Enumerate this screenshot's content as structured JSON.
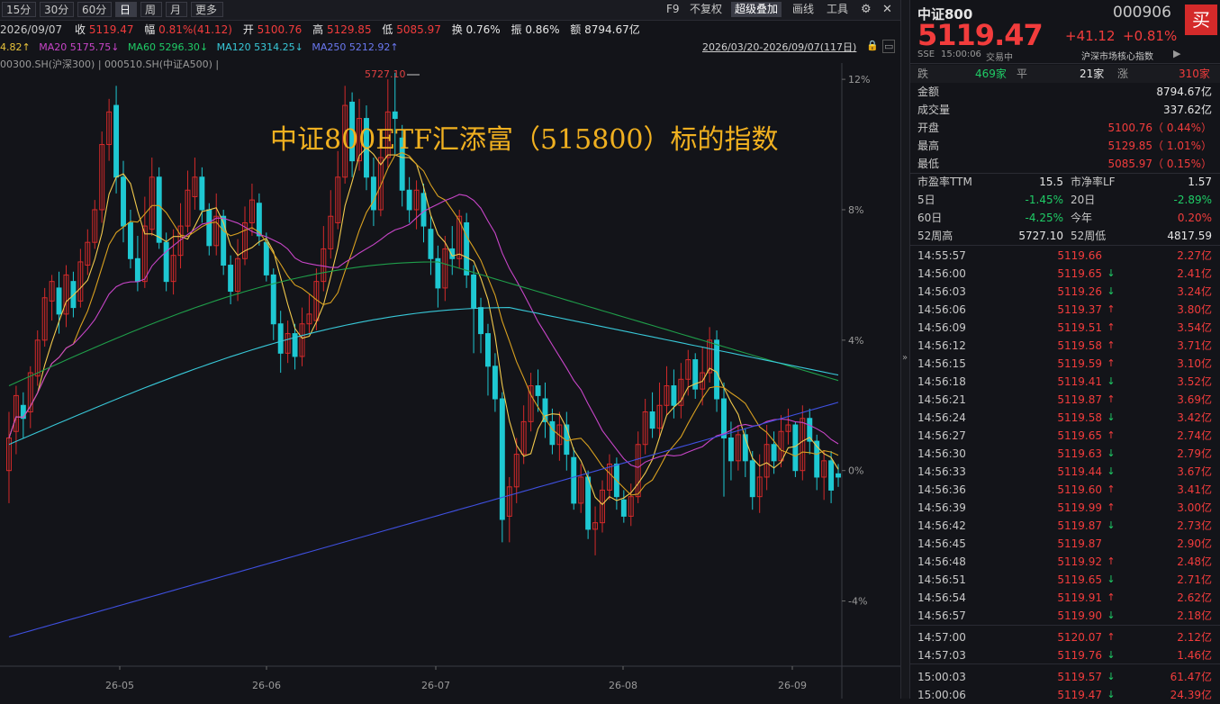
{
  "toolbar": {
    "periods": [
      "15分",
      "30分",
      "60分",
      "日",
      "周",
      "月",
      "更多"
    ],
    "active_period": "日",
    "right_items": [
      "F9",
      "不复权",
      "超级叠加",
      "画线",
      "工具"
    ],
    "active_right": "超级叠加"
  },
  "quote_line": {
    "date": "2026/09/07",
    "close_label": "收",
    "close": "5119.47",
    "change_label": "幅",
    "change": "0.81%(41.12)",
    "open_label": "开",
    "open": "5100.76",
    "high_label": "高",
    "high": "5129.85",
    "low_label": "低",
    "low": "5085.97",
    "turnover_label": "换",
    "turnover": "0.76%",
    "amplitude_label": "振",
    "amplitude": "0.86%",
    "amount_label": "额",
    "amount": "8794.67亿"
  },
  "ma_line": {
    "ma10": "4.82↑",
    "ma20": "MA20 5175.75↓",
    "ma60": "MA60 5296.30↓",
    "ma120": "MA120 5314.25↓",
    "ma250": "MA250 5212.92↑",
    "range": "2026/03/20-2026/09/07(117日)"
  },
  "overlay_line": "00300.SH(沪深300) | 000510.SH(中证A500) |",
  "annotation": "中证800ETF汇添富（515800）标的指数",
  "peak_label": "5727.10",
  "colors": {
    "up": "#d42a2a",
    "down": "#1ec8d2",
    "ma5": "#e6b422",
    "ma10": "#e6b422",
    "ma20": "#c845c8",
    "ma60": "#1f9e4a",
    "ma120": "#38c8d8",
    "ma250": "#3f50e0",
    "annotation": "#f0b020"
  },
  "chart_data": {
    "type": "candlestick",
    "x_labels": [
      "26-05",
      "26-06",
      "26-07",
      "26-08",
      "26-09"
    ],
    "y_ticks": [
      "12%",
      "8%",
      "4%",
      "0%",
      "-4%"
    ],
    "ylim_pct": [
      -6,
      12.5
    ],
    "series_pct": [
      [
        0.0,
        1.0,
        -1.0,
        1.8
      ],
      [
        1.2,
        2.3,
        0.5,
        2.6
      ],
      [
        2.0,
        1.6,
        1.0,
        2.4
      ],
      [
        1.8,
        3.0,
        1.3,
        3.2
      ],
      [
        2.9,
        4.0,
        2.6,
        4.3
      ],
      [
        4.0,
        5.3,
        3.8,
        5.6
      ],
      [
        5.2,
        5.8,
        4.6,
        6.0
      ],
      [
        5.6,
        4.8,
        4.2,
        6.1
      ],
      [
        4.8,
        6.0,
        4.4,
        6.3
      ],
      [
        5.8,
        5.0,
        4.7,
        6.1
      ],
      [
        5.2,
        6.4,
        5.0,
        6.8
      ],
      [
        6.3,
        7.0,
        6.0,
        7.4
      ],
      [
        7.0,
        8.0,
        6.8,
        8.3
      ],
      [
        8.0,
        10.0,
        7.6,
        10.4
      ],
      [
        10.0,
        11.0,
        9.5,
        11.4
      ],
      [
        11.2,
        9.0,
        8.5,
        11.8
      ],
      [
        9.0,
        7.5,
        7.0,
        9.5
      ],
      [
        7.6,
        6.5,
        6.2,
        8.0
      ],
      [
        6.5,
        5.8,
        5.5,
        7.2
      ],
      [
        5.8,
        7.5,
        5.6,
        8.4
      ],
      [
        7.4,
        9.0,
        7.2,
        9.6
      ],
      [
        9.0,
        7.0,
        6.8,
        9.3
      ],
      [
        7.0,
        5.8,
        5.5,
        7.3
      ],
      [
        5.8,
        6.6,
        5.4,
        7.4
      ],
      [
        6.6,
        7.5,
        6.2,
        8.2
      ],
      [
        7.5,
        8.6,
        7.3,
        9.2
      ],
      [
        8.4,
        9.0,
        8.0,
        9.6
      ],
      [
        9.0,
        8.0,
        7.6,
        9.3
      ],
      [
        8.0,
        6.9,
        6.6,
        8.2
      ],
      [
        6.9,
        7.8,
        6.6,
        8.5
      ],
      [
        7.8,
        6.3,
        6.0,
        8.0
      ],
      [
        6.3,
        5.5,
        5.1,
        6.6
      ],
      [
        5.5,
        6.5,
        5.2,
        7.1
      ],
      [
        6.5,
        7.6,
        6.3,
        8.1
      ],
      [
        7.6,
        8.3,
        7.2,
        8.8
      ],
      [
        8.2,
        7.2,
        6.9,
        8.5
      ],
      [
        7.0,
        6.0,
        5.8,
        7.3
      ],
      [
        6.0,
        4.5,
        4.0,
        6.2
      ],
      [
        4.5,
        3.6,
        3.0,
        4.9
      ],
      [
        3.6,
        4.2,
        3.3,
        4.6
      ],
      [
        4.2,
        3.5,
        3.1,
        4.5
      ],
      [
        3.5,
        4.5,
        3.2,
        5.0
      ],
      [
        4.5,
        4.8,
        4.2,
        5.4
      ],
      [
        4.6,
        5.8,
        4.3,
        6.2
      ],
      [
        5.8,
        6.8,
        5.5,
        7.5
      ],
      [
        6.8,
        7.8,
        6.5,
        8.6
      ],
      [
        7.6,
        9.0,
        7.4,
        9.8
      ],
      [
        9.0,
        11.2,
        8.8,
        11.8
      ],
      [
        11.3,
        9.5,
        9.0,
        11.6
      ],
      [
        9.5,
        10.8,
        9.2,
        11.4
      ],
      [
        10.8,
        9.0,
        8.6,
        11.2
      ],
      [
        9.0,
        8.0,
        7.5,
        9.6
      ],
      [
        8.0,
        9.6,
        7.8,
        10.4
      ],
      [
        9.6,
        11.0,
        9.3,
        12.0
      ],
      [
        11.0,
        10.8,
        9.7,
        12.2
      ],
      [
        10.2,
        8.6,
        8.1,
        10.6
      ],
      [
        8.6,
        8.0,
        7.6,
        9.0
      ],
      [
        8.0,
        8.6,
        7.4,
        8.9
      ],
      [
        8.5,
        7.5,
        7.0,
        8.8
      ],
      [
        7.4,
        6.5,
        6.0,
        7.8
      ],
      [
        6.5,
        5.6,
        5.0,
        6.9
      ],
      [
        5.6,
        6.8,
        5.2,
        7.2
      ],
      [
        6.8,
        6.5,
        6.0,
        7.5
      ],
      [
        6.5,
        7.8,
        6.2,
        8.0
      ],
      [
        7.6,
        6.0,
        5.6,
        7.9
      ],
      [
        6.0,
        5.0,
        3.6,
        6.3
      ],
      [
        5.0,
        4.2,
        3.6,
        5.3
      ],
      [
        4.2,
        3.2,
        2.3,
        4.5
      ],
      [
        3.2,
        2.2,
        1.8,
        3.6
      ],
      [
        2.2,
        -1.5,
        -2.2,
        2.4
      ],
      [
        -1.4,
        -0.5,
        -2.2,
        -0.2
      ],
      [
        -0.5,
        0.5,
        -1.0,
        1.0
      ],
      [
        0.5,
        1.5,
        0.2,
        2.0
      ],
      [
        1.5,
        2.6,
        1.2,
        3.0
      ],
      [
        2.6,
        2.3,
        1.8,
        3.1
      ],
      [
        2.2,
        1.5,
        1.0,
        2.7
      ],
      [
        1.5,
        0.8,
        0.5,
        1.9
      ],
      [
        0.8,
        1.4,
        0.3,
        1.8
      ],
      [
        1.4,
        0.5,
        0.0,
        1.8
      ],
      [
        0.4,
        -1.0,
        -1.2,
        0.7
      ],
      [
        -1.0,
        -0.2,
        -1.3,
        0.2
      ],
      [
        -0.2,
        -1.8,
        -2.1,
        0.0
      ],
      [
        -1.8,
        -1.6,
        -2.6,
        -1.1
      ],
      [
        -1.6,
        -0.6,
        -1.9,
        -0.3
      ],
      [
        -0.6,
        0.2,
        -0.9,
        0.5
      ],
      [
        0.2,
        -0.8,
        -1.2,
        0.4
      ],
      [
        -0.9,
        -1.4,
        -1.6,
        -0.6
      ],
      [
        -1.4,
        -0.8,
        -1.7,
        -0.4
      ],
      [
        -0.8,
        0.8,
        -1.0,
        1.2
      ],
      [
        0.8,
        1.8,
        0.5,
        2.2
      ],
      [
        1.8,
        1.3,
        1.0,
        2.4
      ],
      [
        1.3,
        2.0,
        1.0,
        2.7
      ],
      [
        2.0,
        2.6,
        1.7,
        3.2
      ],
      [
        2.6,
        2.0,
        1.6,
        3.1
      ],
      [
        2.0,
        2.8,
        1.6,
        3.3
      ],
      [
        2.8,
        3.4,
        2.3,
        3.7
      ],
      [
        3.4,
        2.5,
        2.2,
        3.6
      ],
      [
        2.5,
        3.0,
        2.0,
        3.8
      ],
      [
        3.0,
        4.0,
        2.7,
        4.4
      ],
      [
        4.0,
        2.2,
        1.8,
        4.3
      ],
      [
        2.2,
        1.0,
        -0.8,
        2.7
      ],
      [
        1.0,
        0.3,
        -0.3,
        1.5
      ],
      [
        0.3,
        1.1,
        0.0,
        1.4
      ],
      [
        1.1,
        0.3,
        -0.2,
        1.3
      ],
      [
        0.3,
        -0.8,
        -1.2,
        0.6
      ],
      [
        -0.8,
        -0.2,
        -1.3,
        0.5
      ],
      [
        -0.2,
        0.8,
        -0.6,
        1.4
      ],
      [
        0.8,
        0.3,
        -0.1,
        1.2
      ],
      [
        0.3,
        1.2,
        0.1,
        1.7
      ],
      [
        1.2,
        1.4,
        0.8,
        1.9
      ],
      [
        1.4,
        0.0,
        -0.2,
        1.5
      ],
      [
        0.0,
        1.6,
        -0.3,
        2.0
      ],
      [
        1.6,
        0.9,
        0.5,
        1.9
      ],
      [
        0.9,
        -0.2,
        -0.6,
        1.1
      ],
      [
        -0.2,
        0.3,
        -0.9,
        0.6
      ],
      [
        0.3,
        -0.6,
        -1.0,
        0.6
      ],
      [
        -0.1,
        -0.2,
        -0.5,
        0.2
      ]
    ]
  },
  "right_panel": {
    "name": "中证800",
    "code": "000906",
    "buy_label": "买",
    "price": "5119.47",
    "change": "+41.12",
    "change_pct": "+0.81%",
    "exchange": "SSE",
    "time": "15:00:06",
    "status": "交易中",
    "category": "沪深市场核心指数",
    "breadth": {
      "fall_label": "跌",
      "fall": "469家",
      "flat_label": "平",
      "flat": "21家",
      "rise_label": "涨",
      "rise": "310家"
    },
    "stats": [
      {
        "label": "金额",
        "value": "8794.67亿",
        "color": "white"
      },
      {
        "label": "成交量",
        "value": "337.62亿",
        "color": "white"
      },
      {
        "label": "开盘",
        "value": "5100.76（ 0.44%）",
        "color": "red"
      },
      {
        "label": "最高",
        "value": "5129.85（ 1.01%）",
        "color": "red"
      },
      {
        "label": "最低",
        "value": "5085.97（ 0.15%）",
        "color": "red"
      }
    ],
    "metrics": [
      {
        "l1": "市盈率TTM",
        "v1": "15.5",
        "c1": "white",
        "l2": "市净率LF",
        "v2": "1.57",
        "c2": "white"
      },
      {
        "l1": "5日",
        "v1": "-1.45%",
        "c1": "green",
        "l2": "20日",
        "v2": "-2.89%",
        "c2": "green"
      },
      {
        "l1": "60日",
        "v1": "-4.25%",
        "c1": "green",
        "l2": "今年",
        "v2": "0.20%",
        "c2": "red"
      },
      {
        "l1": "52周高",
        "v1": "5727.10",
        "c1": "white",
        "l2": "52周低",
        "v2": "4817.59",
        "c2": "white"
      }
    ],
    "ticks": [
      {
        "t": "14:55:57",
        "p": "5119.66",
        "a": "",
        "v": "2.27亿"
      },
      {
        "t": "14:56:00",
        "p": "5119.65",
        "a": "down",
        "v": "2.41亿"
      },
      {
        "t": "14:56:03",
        "p": "5119.26",
        "a": "down",
        "v": "3.24亿"
      },
      {
        "t": "14:56:06",
        "p": "5119.37",
        "a": "up",
        "v": "3.80亿"
      },
      {
        "t": "14:56:09",
        "p": "5119.51",
        "a": "up",
        "v": "3.54亿"
      },
      {
        "t": "14:56:12",
        "p": "5119.58",
        "a": "up",
        "v": "3.71亿"
      },
      {
        "t": "14:56:15",
        "p": "5119.59",
        "a": "up",
        "v": "3.10亿"
      },
      {
        "t": "14:56:18",
        "p": "5119.41",
        "a": "down",
        "v": "3.52亿"
      },
      {
        "t": "14:56:21",
        "p": "5119.87",
        "a": "up",
        "v": "3.69亿"
      },
      {
        "t": "14:56:24",
        "p": "5119.58",
        "a": "down",
        "v": "3.42亿"
      },
      {
        "t": "14:56:27",
        "p": "5119.65",
        "a": "up",
        "v": "2.74亿"
      },
      {
        "t": "14:56:30",
        "p": "5119.63",
        "a": "down",
        "v": "2.79亿"
      },
      {
        "t": "14:56:33",
        "p": "5119.44",
        "a": "down",
        "v": "3.67亿"
      },
      {
        "t": "14:56:36",
        "p": "5119.60",
        "a": "up",
        "v": "3.41亿"
      },
      {
        "t": "14:56:39",
        "p": "5119.99",
        "a": "up",
        "v": "3.00亿"
      },
      {
        "t": "14:56:42",
        "p": "5119.87",
        "a": "down",
        "v": "2.73亿"
      },
      {
        "t": "14:56:45",
        "p": "5119.87",
        "a": "",
        "v": "2.90亿"
      },
      {
        "t": "14:56:48",
        "p": "5119.92",
        "a": "up",
        "v": "2.48亿"
      },
      {
        "t": "14:56:51",
        "p": "5119.65",
        "a": "down",
        "v": "2.71亿"
      },
      {
        "t": "14:56:54",
        "p": "5119.91",
        "a": "up",
        "v": "2.62亿"
      },
      {
        "t": "14:56:57",
        "p": "5119.90",
        "a": "down",
        "v": "2.18亿"
      },
      {
        "t": "14:57:00",
        "p": "5120.07",
        "a": "up",
        "v": "2.12亿"
      },
      {
        "t": "14:57:03",
        "p": "5119.76",
        "a": "down",
        "v": "1.46亿"
      },
      {
        "t": "15:00:03",
        "p": "5119.57",
        "a": "down",
        "v": "61.47亿"
      },
      {
        "t": "15:00:06",
        "p": "5119.47",
        "a": "down",
        "v": "24.39亿"
      }
    ]
  }
}
